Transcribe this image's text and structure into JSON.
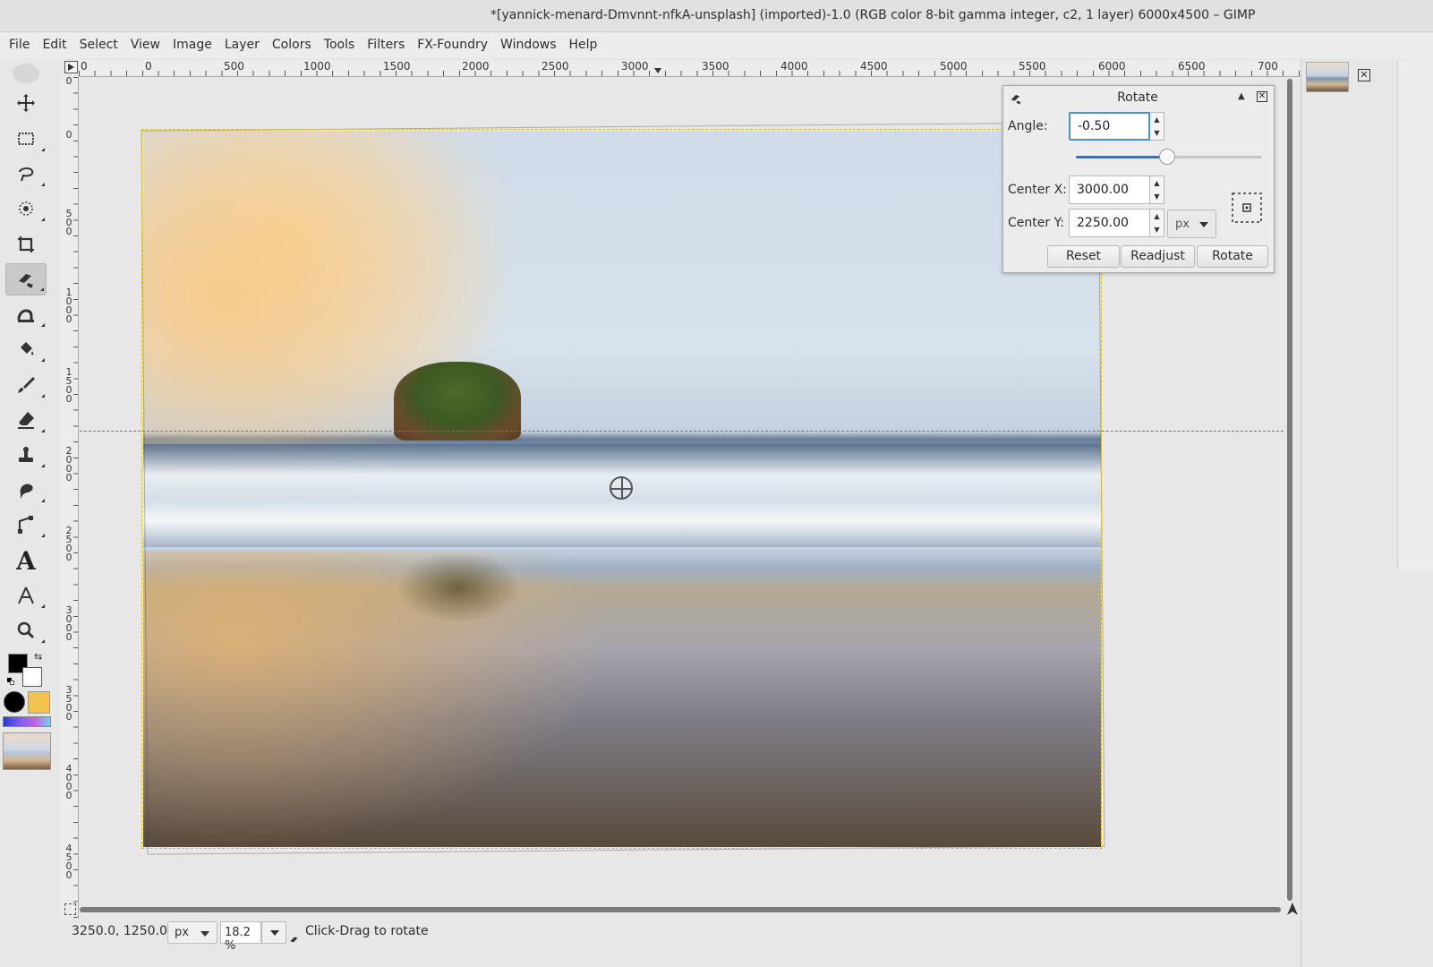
{
  "window": {
    "title": "*[yannick-menard-Dmvnnt-nfkA-unsplash] (imported)-1.0 (RGB color 8-bit gamma integer, c2, 1 layer) 6000x4500 – GIMP"
  },
  "menubar": {
    "items": [
      "File",
      "Edit",
      "Select",
      "View",
      "Image",
      "Layer",
      "Colors",
      "Tools",
      "Filters",
      "FX-Foundry",
      "Windows",
      "Help"
    ]
  },
  "toolbox": {
    "tools": [
      {
        "name": "move-tool-icon"
      },
      {
        "name": "rect-select-tool-icon"
      },
      {
        "name": "free-select-tool-icon"
      },
      {
        "name": "fuzzy-select-tool-icon"
      },
      {
        "name": "crop-tool-icon"
      },
      {
        "name": "transform-tool-icon",
        "active": true
      },
      {
        "name": "warp-tool-icon"
      },
      {
        "name": "bucket-fill-tool-icon"
      },
      {
        "name": "paintbrush-tool-icon"
      },
      {
        "name": "eraser-tool-icon"
      },
      {
        "name": "clone-tool-icon"
      },
      {
        "name": "smudge-tool-icon"
      },
      {
        "name": "paths-tool-icon"
      },
      {
        "name": "text-tool-icon"
      },
      {
        "name": "measure-tool-icon"
      },
      {
        "name": "zoom-tool-icon"
      }
    ],
    "text_tool_glyph": "A",
    "swap_glyph": "⇆"
  },
  "ruler": {
    "h_labels": [
      "0",
      "0",
      "500",
      "1000",
      "1500",
      "2000",
      "2500",
      "3000",
      "3500",
      "4000",
      "4500",
      "5000",
      "5500",
      "6000",
      "6500",
      "700"
    ],
    "v_labels": [
      "0",
      "0",
      "500",
      "1000",
      "1500",
      "2000",
      "2500",
      "3000",
      "3500",
      "4000",
      "4500"
    ]
  },
  "rotate_dialog": {
    "title": "Rotate",
    "collapse_glyph": "▲",
    "close_glyph": "✕",
    "angle_label": "Angle:",
    "angle_value": "-0.50",
    "angle_slider_fraction": 0.49,
    "center_x_label": "Center X:",
    "center_x_value": "3000.00",
    "center_y_label": "Center Y:",
    "center_y_value": "2250.00",
    "unit": "px",
    "spin_up": "▲",
    "spin_down": "▼",
    "buttons": {
      "reset": "Reset",
      "readjust": "Readjust",
      "rotate": "Rotate"
    }
  },
  "statusbar": {
    "coords": "3250.0, 1250.0",
    "unit": "px",
    "zoom": "18.2 %",
    "message": "Click-Drag to rotate"
  },
  "dock": {
    "close_glyph": "✕"
  },
  "colors": {
    "accent": "#4a90d9",
    "guide": "#2b8bb8",
    "selection": "#d8c200"
  }
}
